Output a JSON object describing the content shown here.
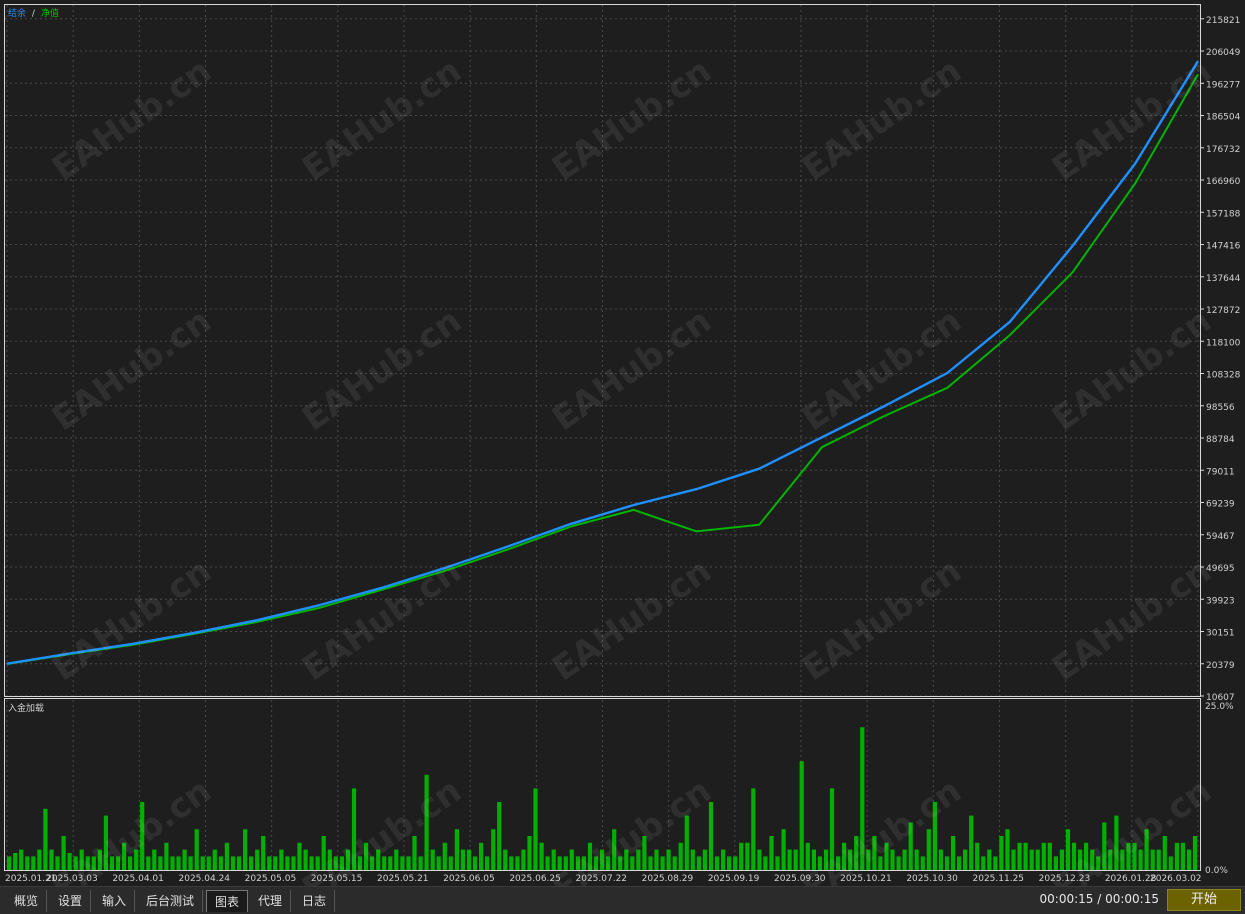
{
  "legend": {
    "balance": "结余",
    "separator": "/",
    "equity": "净值"
  },
  "subpanel": {
    "title": "入金加载",
    "top_label": "25.0%",
    "bottom_label": "0.0%"
  },
  "colors": {
    "balance": "#1e90ff",
    "equity": "#00b400",
    "load": "#00b000",
    "grid": "#4a4a4a",
    "frame": "#d8d8d8"
  },
  "watermark": "EAHub.cn",
  "tabs": [
    "概览",
    "设置",
    "输入",
    "后台测试",
    "图表",
    "代理",
    "日志"
  ],
  "active_tab": "图表",
  "timer": "00:00:15 / 00:00:15",
  "start_button": "开始",
  "chart_data": [
    {
      "type": "line",
      "title": "",
      "series": [
        {
          "name": "结余",
          "values": [
            20400,
            23500,
            26400,
            29800,
            33600,
            38200,
            43500,
            49500,
            56000,
            62800,
            68500,
            73300,
            79500,
            89000,
            98500,
            108500,
            124000,
            147000,
            172000,
            203000
          ]
        },
        {
          "name": "净值",
          "values": [
            20300,
            23300,
            26100,
            29500,
            33100,
            37400,
            42900,
            48600,
            55100,
            62000,
            67000,
            60500,
            62500,
            86000,
            95500,
            104000,
            120000,
            139000,
            166000,
            199000
          ]
        }
      ],
      "x": [
        "2025.01.21",
        "2025.03.03",
        "2025.04.01",
        "2025.04.24",
        "2025.05.05",
        "2025.05.15",
        "2025.05.21",
        "2025.06.05",
        "2025.06.25",
        "2025.07.22",
        "2025.08.29",
        "2025.09.19",
        "2025.09.30",
        "2025.10.21",
        "2025.10.30",
        "2025.11.25",
        "2025.12.23",
        "2026.01.28",
        "2026.03.02"
      ],
      "y_ticks": [
        215821,
        206049,
        196277,
        186504,
        176732,
        166960,
        157188,
        147416,
        137644,
        127872,
        118100,
        108328,
        98556,
        88784,
        79011,
        69239,
        59467,
        49695,
        39923,
        30151,
        20379,
        10607
      ],
      "ylim": [
        10607,
        220000
      ],
      "grid": true,
      "legend_position": "top-left"
    },
    {
      "type": "bar",
      "title": "入金加载",
      "ylim": [
        0,
        25
      ],
      "y_ticks": [
        "25.0%",
        "0.0%"
      ],
      "values": [
        2,
        2.5,
        3,
        2,
        2,
        3,
        9,
        3,
        2,
        5,
        2.5,
        2,
        3,
        2,
        2,
        3,
        8,
        2,
        2,
        4,
        2,
        3,
        10,
        2,
        3,
        2,
        4,
        2,
        2,
        3,
        2,
        6,
        2,
        2,
        3,
        2,
        4,
        2,
        2,
        6,
        2,
        3,
        5,
        2,
        2,
        3,
        2,
        2,
        4,
        3,
        2,
        2,
        5,
        3,
        2,
        2,
        3,
        12,
        2,
        4,
        2,
        3,
        2,
        2,
        3,
        2,
        2,
        5,
        2,
        14,
        3,
        2,
        4,
        2,
        6,
        3,
        3,
        2,
        4,
        2,
        6,
        10,
        3,
        2,
        2,
        3,
        5,
        12,
        4,
        2,
        3,
        2,
        2,
        3,
        2,
        2,
        4,
        2,
        3,
        2,
        6,
        2,
        3,
        2,
        3,
        5,
        2,
        3,
        2,
        3,
        2,
        4,
        8,
        3,
        2,
        3,
        10,
        2,
        3,
        2,
        2,
        4,
        4,
        12,
        3,
        2,
        5,
        2,
        6,
        3,
        3,
        16,
        4,
        3,
        2,
        3,
        12,
        2,
        4,
        3,
        5,
        21,
        3,
        5,
        2,
        4,
        3,
        2,
        3,
        7,
        3,
        2,
        6,
        10,
        3,
        2,
        5,
        2,
        3,
        8,
        4,
        2,
        3,
        2,
        5,
        6,
        3,
        4,
        4,
        3,
        3,
        4,
        4,
        2,
        3,
        6,
        4,
        3,
        4,
        3,
        2,
        7,
        3,
        8,
        3,
        4,
        4,
        3,
        6,
        3,
        3,
        5,
        2,
        4,
        4,
        3,
        5
      ]
    }
  ]
}
